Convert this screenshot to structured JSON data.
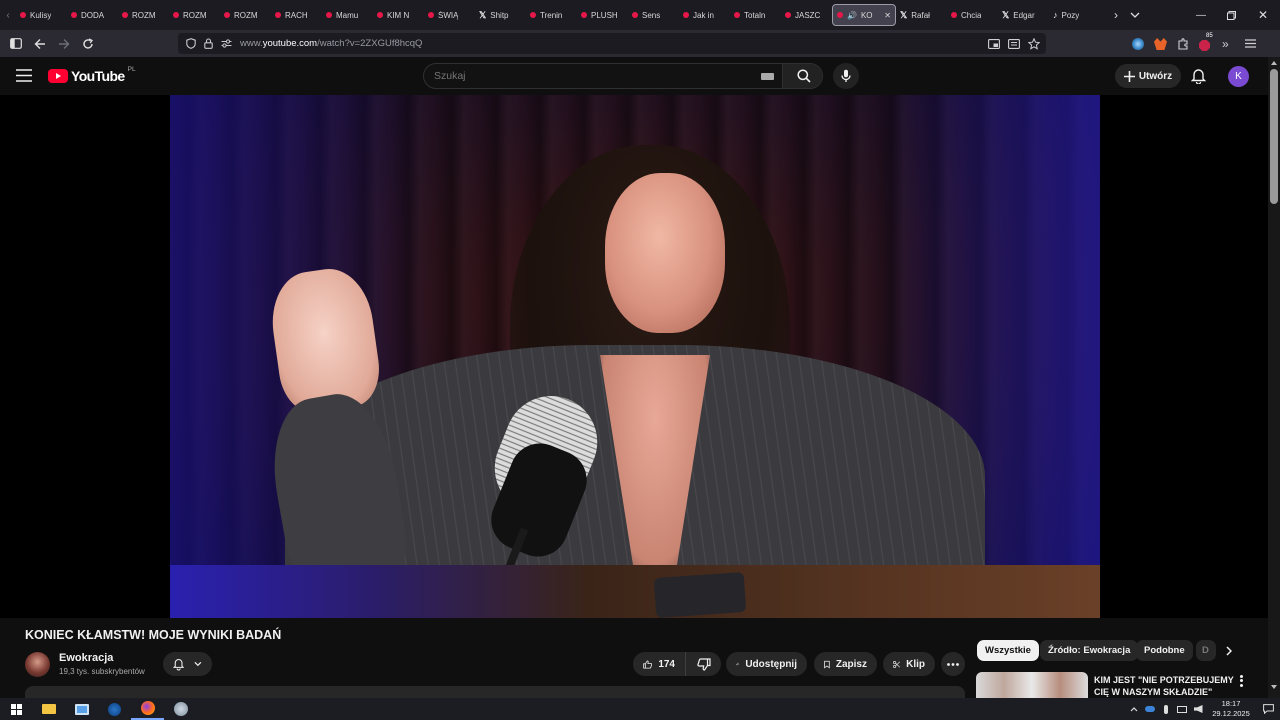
{
  "browser": {
    "tabs": [
      {
        "label": "Kulisy",
        "kind": "youtube"
      },
      {
        "label": "DODA",
        "kind": "youtube"
      },
      {
        "label": "ROZM",
        "kind": "youtube"
      },
      {
        "label": "ROZM",
        "kind": "youtube"
      },
      {
        "label": "ROZM",
        "kind": "youtube"
      },
      {
        "label": "RACH",
        "kind": "youtube"
      },
      {
        "label": "Mamu",
        "kind": "youtube"
      },
      {
        "label": "KIM N",
        "kind": "youtube"
      },
      {
        "label": "ŚWIĄ",
        "kind": "youtube"
      },
      {
        "label": "Shitp",
        "kind": "x"
      },
      {
        "label": "Trenin",
        "kind": "youtube"
      },
      {
        "label": "PLUSH",
        "kind": "youtube"
      },
      {
        "label": "Sens",
        "kind": "youtube"
      },
      {
        "label": "Jak in",
        "kind": "youtube"
      },
      {
        "label": "Totaln",
        "kind": "youtube"
      },
      {
        "label": "JASZC",
        "kind": "youtube"
      },
      {
        "label": "KO",
        "kind": "youtube",
        "active": true,
        "audio": true
      },
      {
        "label": "Rafał",
        "kind": "x"
      },
      {
        "label": "Chcia",
        "kind": "youtube"
      },
      {
        "label": "Edgar",
        "kind": "x"
      },
      {
        "label": "Pozy",
        "kind": "tiktok"
      }
    ],
    "url_prefix": "www.",
    "url_domain": "youtube.com",
    "url_path": "/watch?v=2ZXGUf8hcqQ",
    "extension_badge": "85"
  },
  "youtube": {
    "logo_text": "YouTube",
    "country": "PL",
    "search_placeholder": "Szukaj",
    "create_label": "Utwórz",
    "avatar_letter": "K",
    "accent": "#ff0033"
  },
  "video": {
    "title": "KONIEC KŁAMSTW! MOJE WYNIKI BADAŃ",
    "channel_name": "Ewokracja",
    "subscribers": "19,3 tys. subskrybentów",
    "likes": "174",
    "share_label": "Udostępnij",
    "save_label": "Zapisz",
    "clip_label": "Klip"
  },
  "sidebar": {
    "chips": [
      "Wszystkie",
      "Źródło: Ewokracja",
      "Podobne",
      "D"
    ],
    "first_title": "KIM JEST \"NIE POTRZEBUJEMY CIĘ W NASZYM SKŁADZIE\""
  },
  "taskbar": {
    "time": "18:17",
    "date": "29.12.2025"
  }
}
